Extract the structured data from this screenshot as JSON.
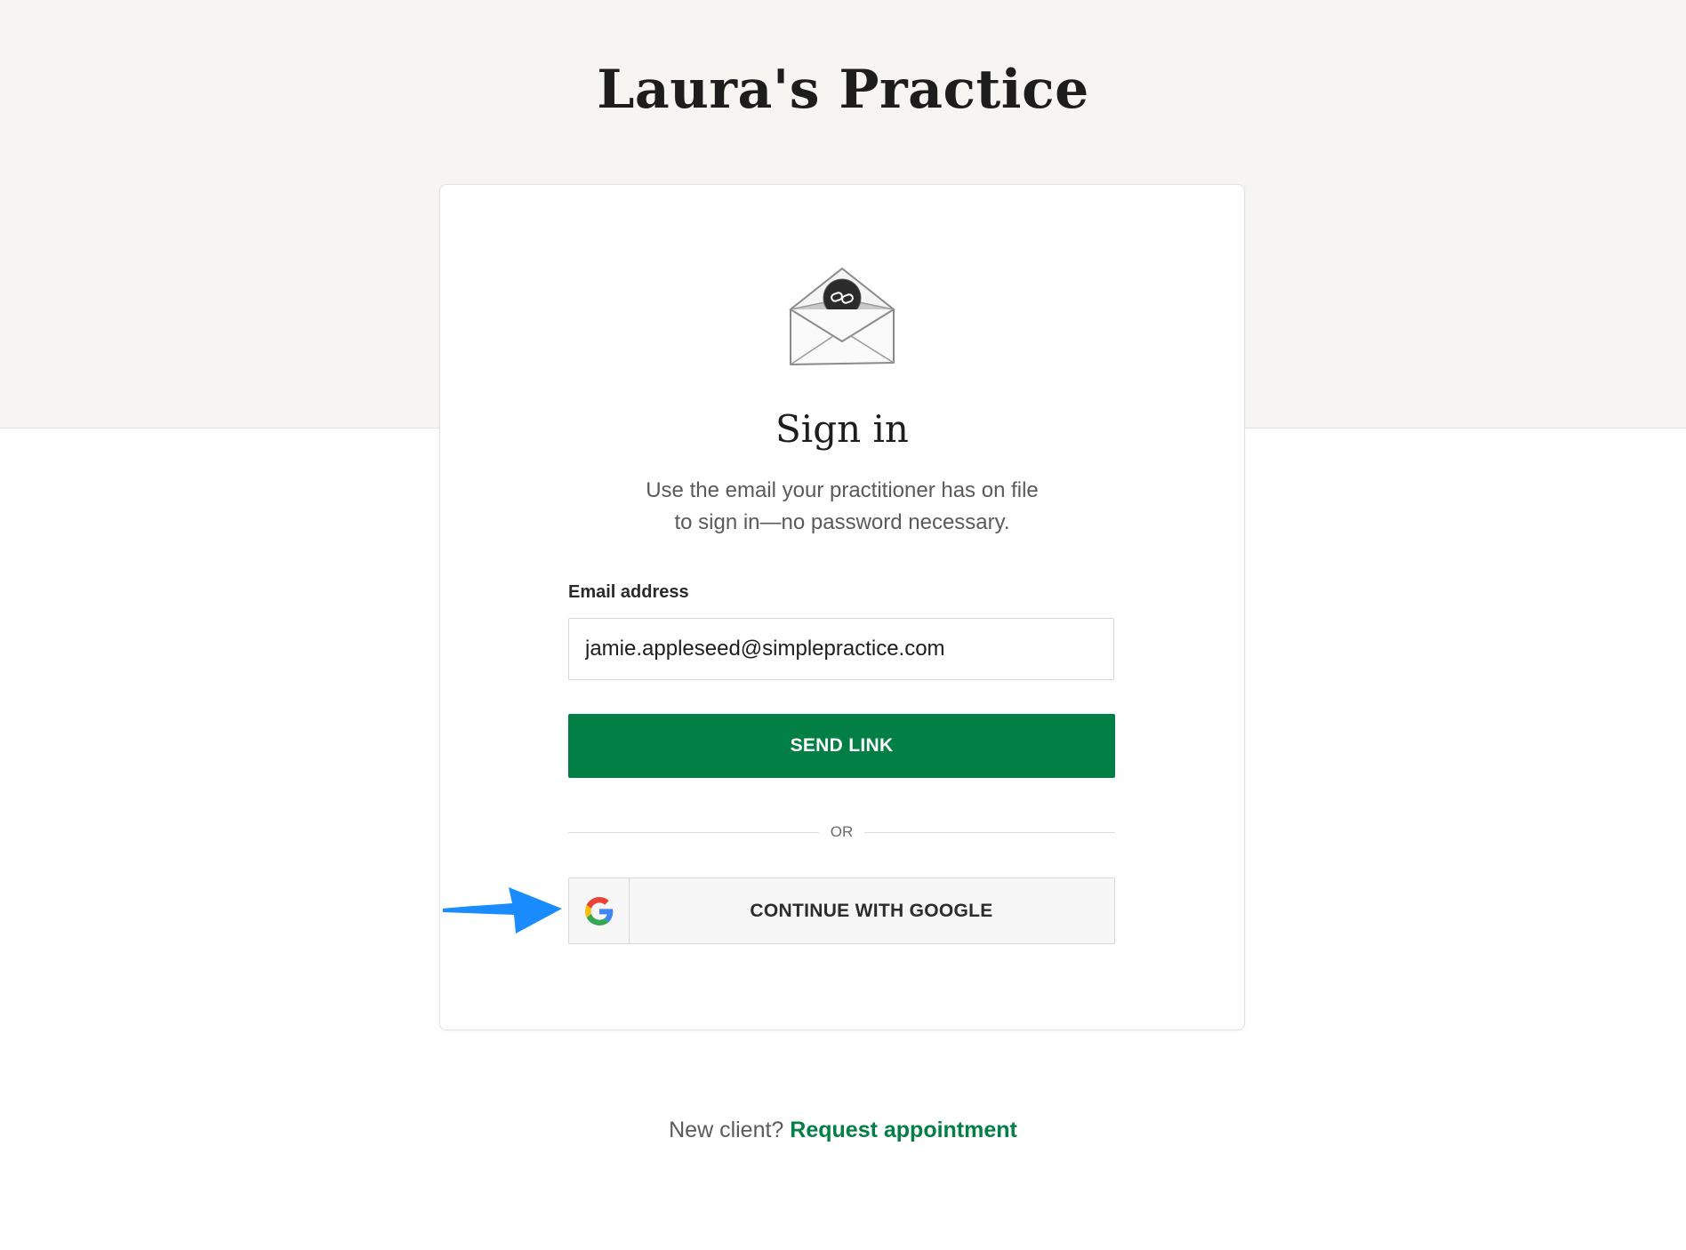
{
  "header": {
    "practice_name": "Laura's Practice"
  },
  "card": {
    "icon": "envelope-link-icon",
    "title": "Sign in",
    "subtitle_line1": "Use the email your practitioner has on file",
    "subtitle_line2": "to sign in—no password necessary.",
    "email_label": "Email address",
    "email_value": "jamie.appleseed@simplepractice.com",
    "send_link_label": "SEND LINK",
    "or_text": "OR",
    "google_label": "CONTINUE WITH GOOGLE",
    "google_icon": "google-g-icon"
  },
  "annotation": {
    "icon": "pointer-arrow-icon",
    "color": "#1a8cff"
  },
  "footer": {
    "prompt": "New client?",
    "link_label": "Request appointment"
  },
  "colors": {
    "brand_green": "#027f44",
    "top_band": "#f6f5f1"
  }
}
